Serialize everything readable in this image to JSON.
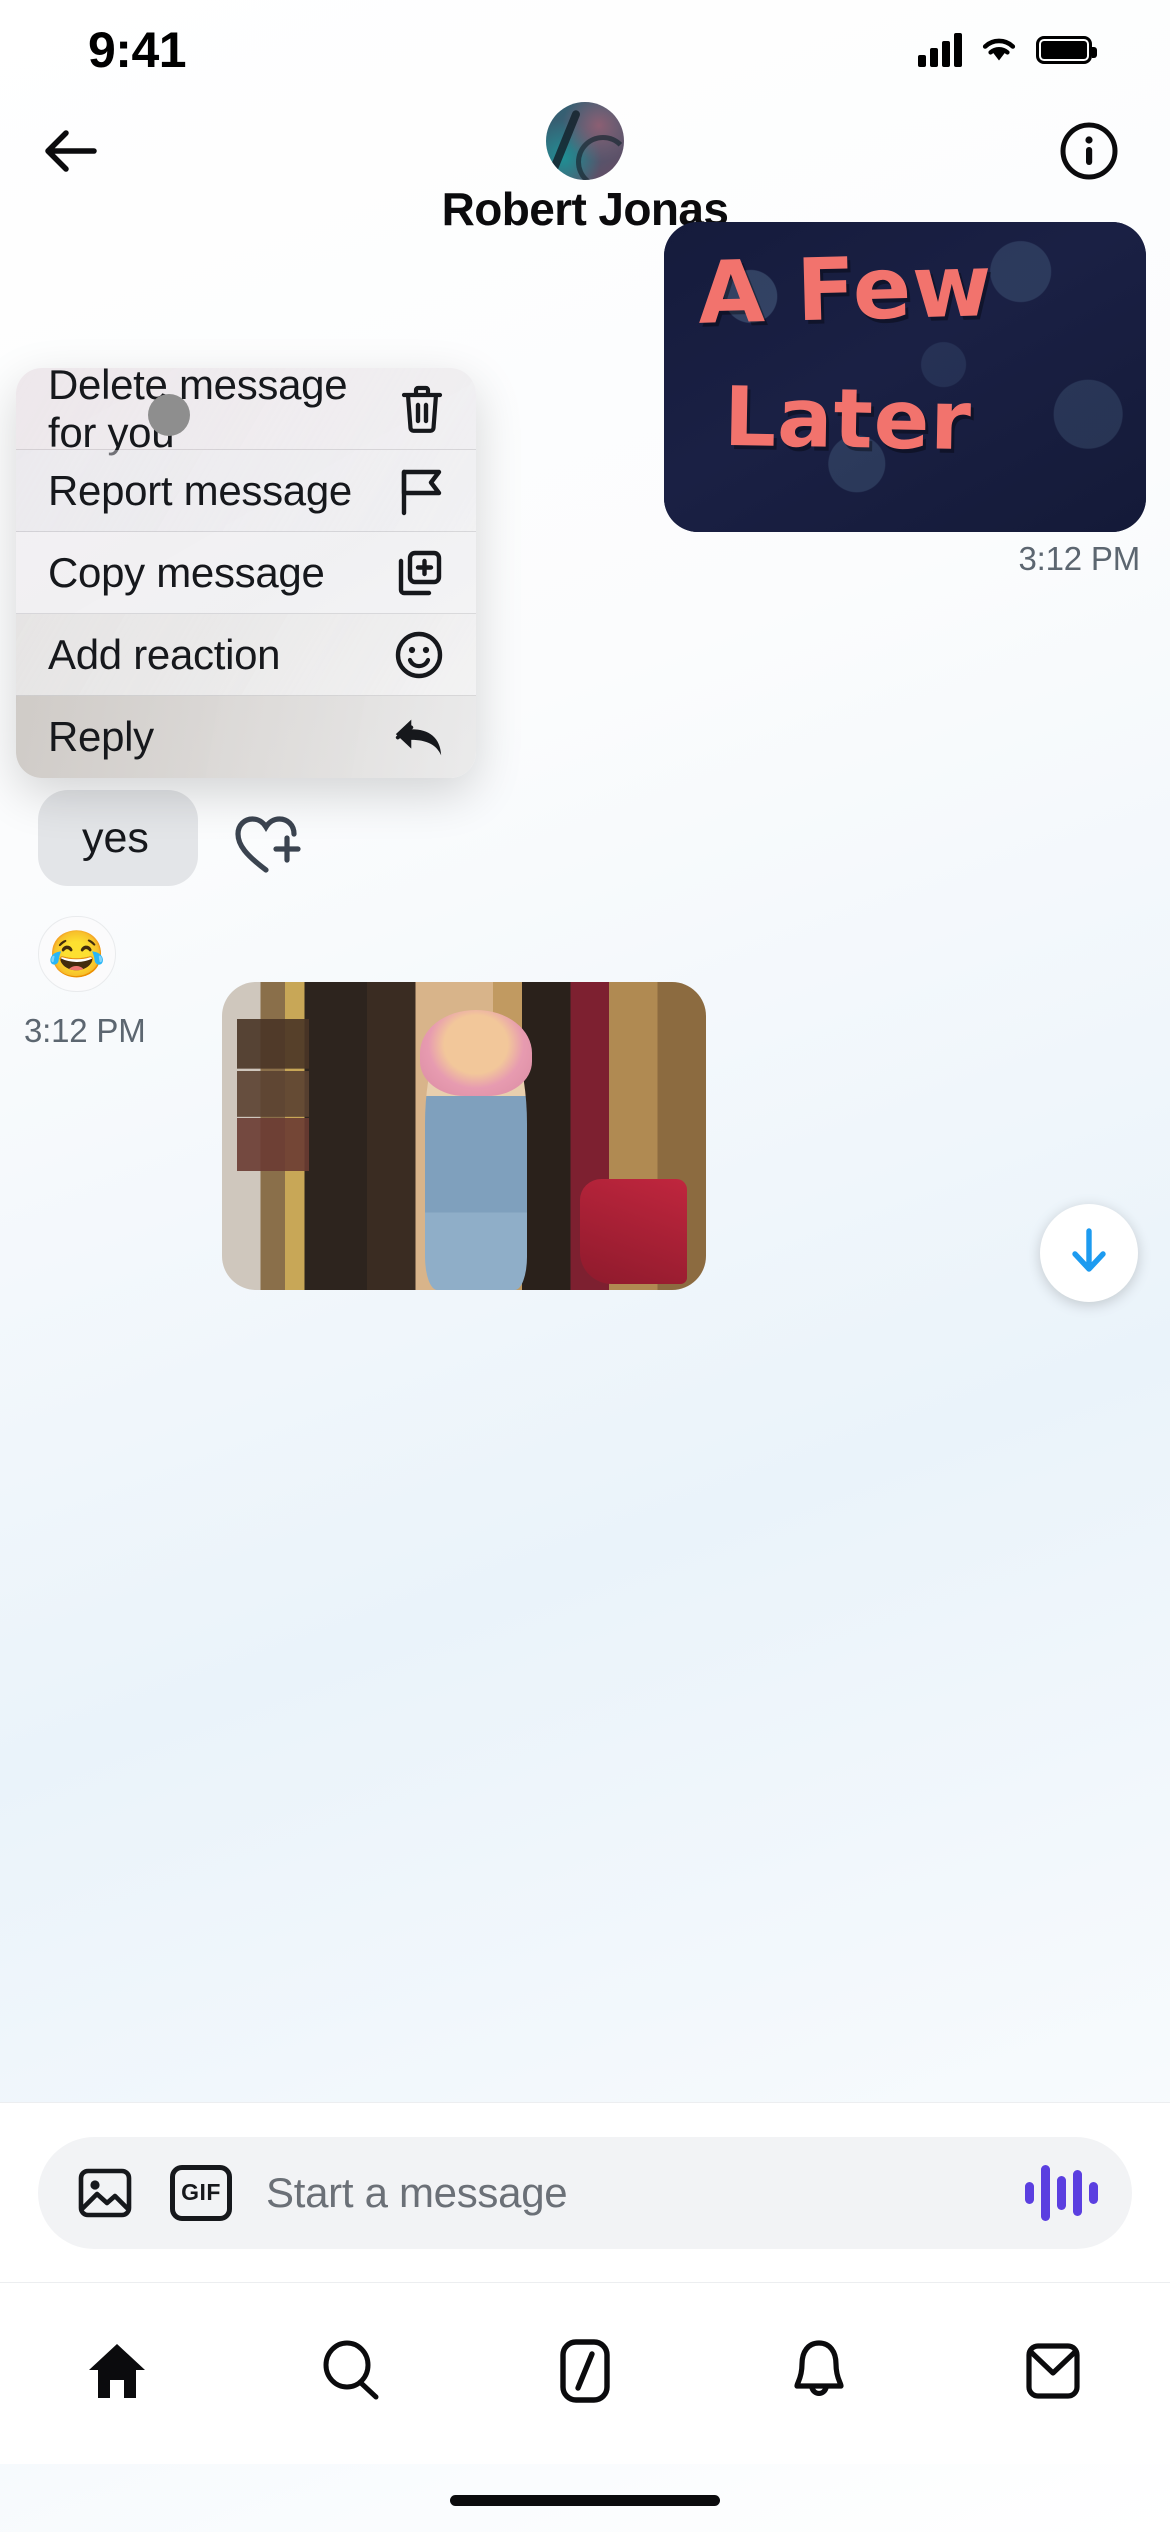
{
  "status_bar": {
    "time": "9:41",
    "signal_icon": "cellular-signal-icon",
    "wifi_icon": "wifi-icon",
    "battery_icon": "battery-icon"
  },
  "header": {
    "back_icon": "back-arrow-icon",
    "info_icon": "info-circle-icon",
    "avatar_name": "conversation-avatar",
    "peer_name": "Robert Jonas"
  },
  "thread": {
    "messages": [
      {
        "id": "meme-image",
        "direction": "outgoing",
        "type": "image",
        "image_text_line1": "A Few",
        "image_text_line2": "Later",
        "timestamp": "3:12 PM"
      },
      {
        "id": "yes-text",
        "direction": "incoming",
        "type": "text",
        "text": "yes",
        "reaction": "😂",
        "timestamp": "3:12 PM"
      },
      {
        "id": "photo",
        "direction": "incoming",
        "type": "image",
        "alt": "woman-with-pink-hair-in-vintage-shop"
      }
    ],
    "add_reaction_icon": "heart-plus-icon",
    "scroll_down_icon": "arrow-down-icon",
    "scroll_down_color": "#1d9bf0"
  },
  "context_menu": {
    "items": [
      {
        "label": "Delete message for you",
        "icon": "trash-icon",
        "highlighted": false
      },
      {
        "label": "Report message",
        "icon": "flag-icon",
        "highlighted": false
      },
      {
        "label": "Copy message",
        "icon": "copy-plus-icon",
        "highlighted": false
      },
      {
        "label": "Add reaction",
        "icon": "smiley-icon",
        "highlighted": false
      },
      {
        "label": "Reply",
        "icon": "reply-arrow-icon",
        "highlighted": true
      }
    ]
  },
  "composer": {
    "media_icon": "image-icon",
    "gif_icon": "gif-icon",
    "gif_label": "GIF",
    "placeholder": "Start a message",
    "voice_icon": "audio-waveform-icon",
    "voice_color": "#5b3fe0"
  },
  "tab_bar": {
    "tabs": [
      {
        "name": "home",
        "icon": "home-icon",
        "selected": true
      },
      {
        "name": "search",
        "icon": "search-icon",
        "selected": false
      },
      {
        "name": "grok",
        "icon": "grok-icon",
        "selected": false
      },
      {
        "name": "notifications",
        "icon": "bell-icon",
        "selected": false
      },
      {
        "name": "messages",
        "icon": "mail-icon",
        "selected": false
      }
    ]
  }
}
